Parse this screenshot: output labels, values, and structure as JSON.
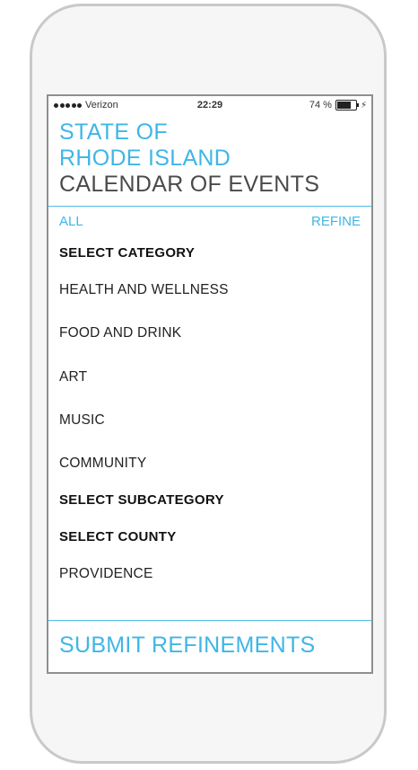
{
  "status_bar": {
    "carrier": "Verizon",
    "time": "22:29",
    "battery": "74 %",
    "battery_level": 0.74
  },
  "header": {
    "title_line1": "STATE OF",
    "title_line2": "RHODE ISLAND",
    "title_line3": "CALENDAR OF EVENTS"
  },
  "nav": {
    "all_label": "ALL",
    "refine_label": "REFINE"
  },
  "category": {
    "heading": "SELECT CATEGORY",
    "items": [
      "HEALTH AND WELLNESS",
      "FOOD AND DRINK",
      "ART",
      "MUSIC",
      "COMMUNITY"
    ]
  },
  "subcategory": {
    "heading": "SELECT SUBCATEGORY"
  },
  "county": {
    "heading": "SELECT COUNTY",
    "items": [
      "PROVIDENCE"
    ]
  },
  "footer": {
    "submit_label": "SUBMIT REFINEMENTS"
  },
  "colors": {
    "accent": "#3fb6e6",
    "text": "#222222"
  }
}
